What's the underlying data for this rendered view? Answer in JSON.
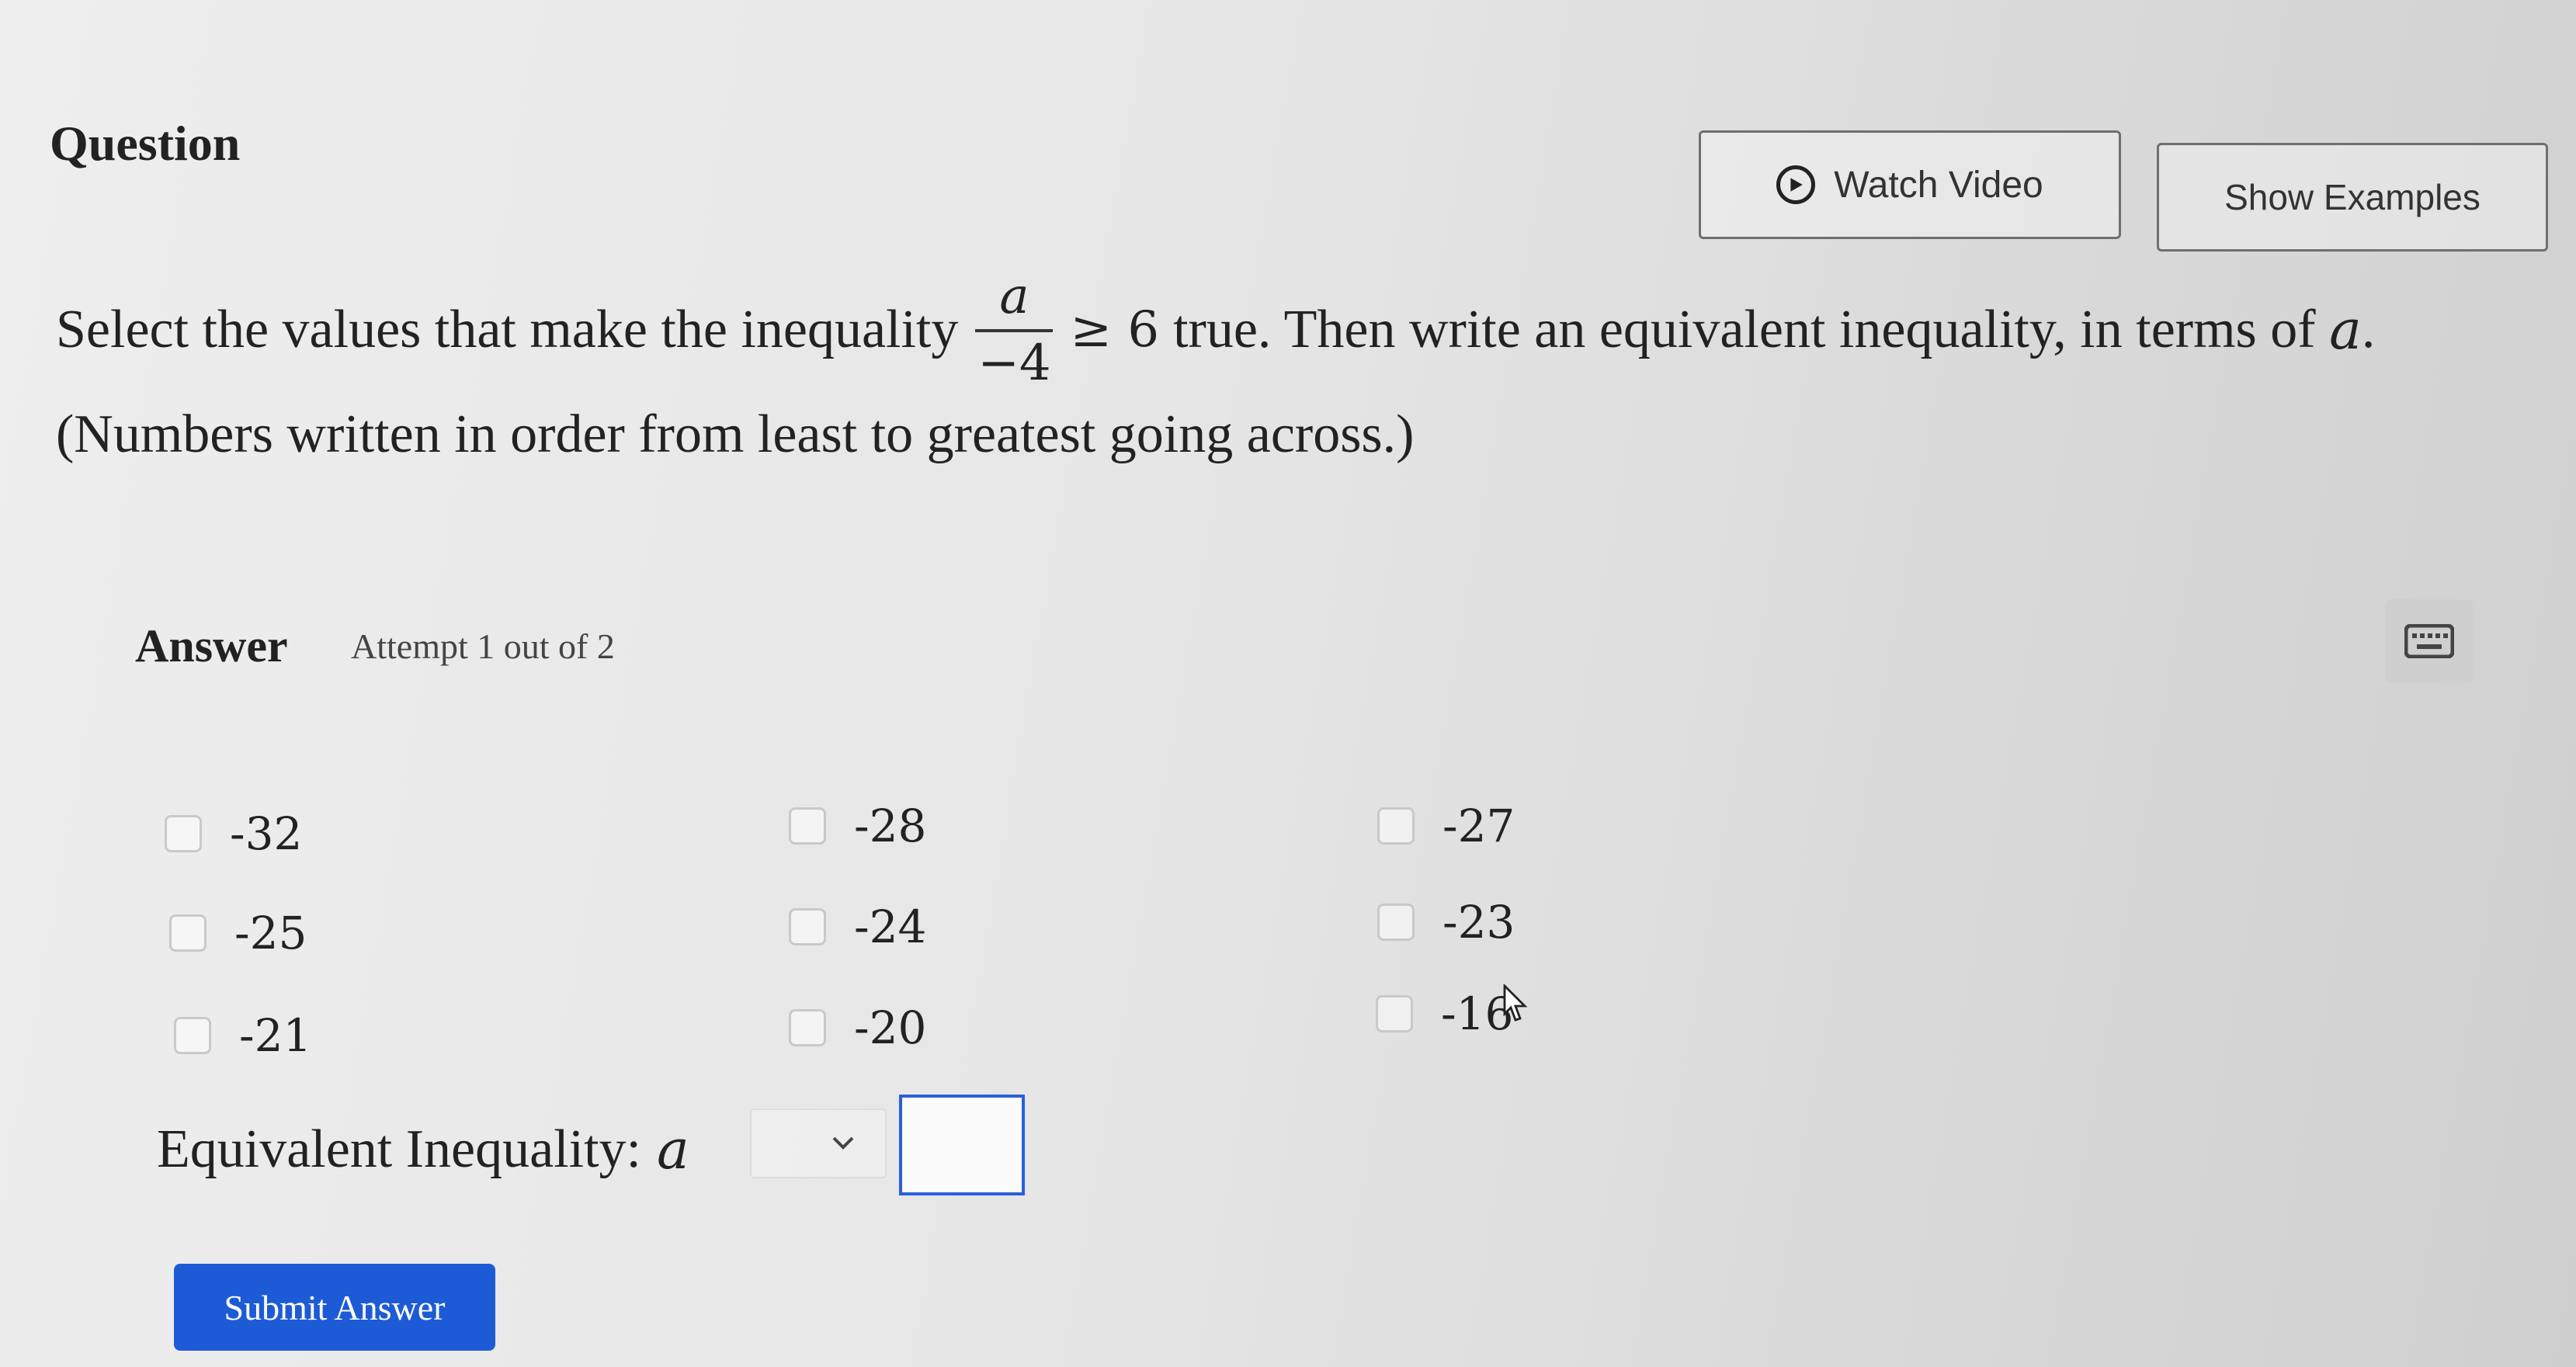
{
  "header": {
    "title": "Question",
    "watch_video_label": "Watch Video",
    "show_examples_label": "Show Examples"
  },
  "prompt": {
    "text_before": "Select the values that make the inequality",
    "numerator": "a",
    "denominator": "−4",
    "relation": "≥ 6",
    "text_middle": "true. Then write an equivalent inequality, in terms of",
    "variable": "a",
    "text_end": ".",
    "note": "(Numbers written in order from least to greatest going across.)"
  },
  "answer": {
    "label": "Answer",
    "attempt": "Attempt 1 out of 2"
  },
  "options": [
    {
      "label": "-32",
      "checked": false
    },
    {
      "label": "-28",
      "checked": false
    },
    {
      "label": "-27",
      "checked": false
    },
    {
      "label": "-25",
      "checked": false
    },
    {
      "label": "-24",
      "checked": false
    },
    {
      "label": "-23",
      "checked": false
    },
    {
      "label": "-21",
      "checked": false
    },
    {
      "label": "-20",
      "checked": false
    },
    {
      "label": "-16",
      "checked": false
    }
  ],
  "equivalent": {
    "label": "Equivalent Inequality:",
    "variable": "a",
    "selected_relation": "",
    "value": ""
  },
  "submit_label": "Submit Answer",
  "colors": {
    "accent": "#1d5bd6",
    "answer_box_border": "#2b5fd9"
  },
  "icons": [
    "play-circle-icon",
    "keyboard-icon",
    "chevron-down-icon",
    "mouse-pointer-icon"
  ]
}
